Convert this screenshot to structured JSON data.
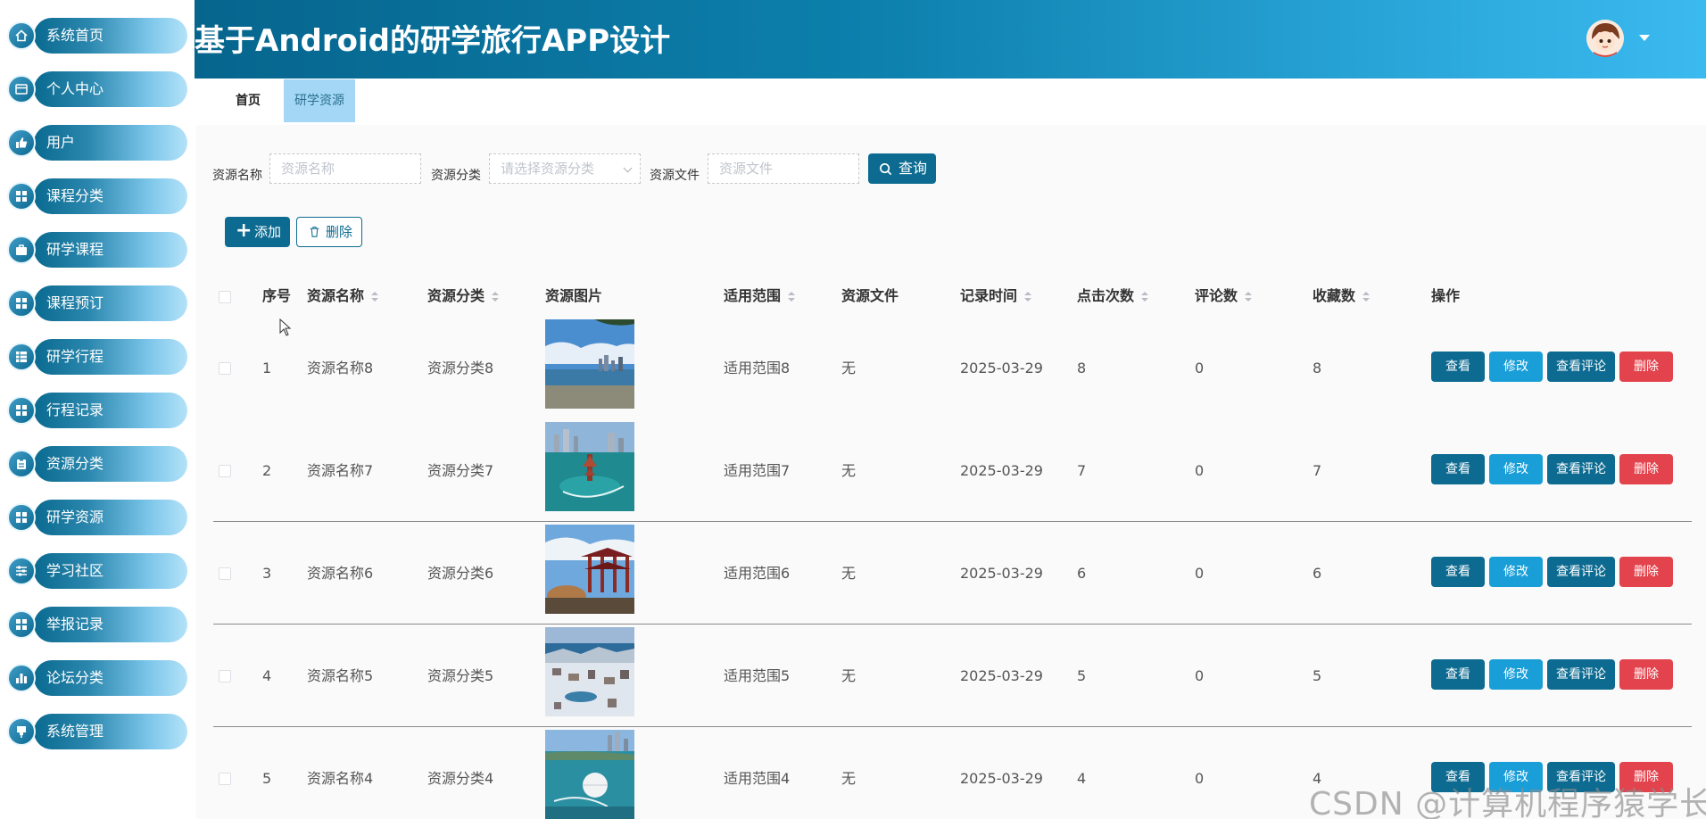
{
  "app": {
    "title": "基于Android的研学旅行APP设计"
  },
  "sidebar": {
    "items": [
      {
        "label": "系统首页",
        "icon": "home-icon"
      },
      {
        "label": "个人中心",
        "icon": "card-icon"
      },
      {
        "label": "用户",
        "icon": "thumb-icon"
      },
      {
        "label": "课程分类",
        "icon": "grid-icon"
      },
      {
        "label": "研学课程",
        "icon": "briefcase-icon"
      },
      {
        "label": "课程预订",
        "icon": "grid-icon"
      },
      {
        "label": "研学行程",
        "icon": "table-icon"
      },
      {
        "label": "行程记录",
        "icon": "grid-icon"
      },
      {
        "label": "资源分类",
        "icon": "clipboard-icon"
      },
      {
        "label": "研学资源",
        "icon": "grid-icon"
      },
      {
        "label": "学习社区",
        "icon": "sliders-icon"
      },
      {
        "label": "举报记录",
        "icon": "grid-icon"
      },
      {
        "label": "论坛分类",
        "icon": "bar-chart-icon"
      },
      {
        "label": "系统管理",
        "icon": "pin-icon"
      }
    ]
  },
  "tabs": [
    {
      "label": "首页",
      "active": false
    },
    {
      "label": "研学资源",
      "active": true
    }
  ],
  "search": {
    "name_label": "资源名称",
    "name_placeholder": "资源名称",
    "category_label": "资源分类",
    "category_placeholder": "请选择资源分类",
    "file_label": "资源文件",
    "file_placeholder": "资源文件",
    "query_button": "查询"
  },
  "toolbar": {
    "add_label": "添加",
    "delete_label": "删除"
  },
  "table": {
    "headers": {
      "index": "序号",
      "name": "资源名称",
      "category": "资源分类",
      "image": "资源图片",
      "scope": "适用范围",
      "file": "资源文件",
      "time": "记录时间",
      "clicks": "点击次数",
      "comments": "评论数",
      "favorites": "收藏数",
      "actions": "操作"
    },
    "action_labels": {
      "view": "查看",
      "edit": "修改",
      "comments": "查看评论",
      "delete": "删除"
    },
    "rows": [
      {
        "index": "1",
        "name": "资源名称8",
        "category": "资源分类8",
        "scope": "适用范围8",
        "file": "无",
        "time": "2025-03-29",
        "clicks": "8",
        "comments": "0",
        "favorites": "8"
      },
      {
        "index": "2",
        "name": "资源名称7",
        "category": "资源分类7",
        "scope": "适用范围7",
        "file": "无",
        "time": "2025-03-29",
        "clicks": "7",
        "comments": "0",
        "favorites": "7"
      },
      {
        "index": "3",
        "name": "资源名称6",
        "category": "资源分类6",
        "scope": "适用范围6",
        "file": "无",
        "time": "2025-03-29",
        "clicks": "6",
        "comments": "0",
        "favorites": "6"
      },
      {
        "index": "4",
        "name": "资源名称5",
        "category": "资源分类5",
        "scope": "适用范围5",
        "file": "无",
        "time": "2025-03-29",
        "clicks": "5",
        "comments": "0",
        "favorites": "5"
      },
      {
        "index": "5",
        "name": "资源名称4",
        "category": "资源分类4",
        "scope": "适用范围4",
        "file": "无",
        "time": "2025-03-29",
        "clicks": "4",
        "comments": "0",
        "favorites": "4"
      }
    ]
  },
  "watermark": "CSDN @计算机程序猿学长",
  "colors": {
    "primary": "#0d6b91",
    "secondary": "#1a9ed8",
    "danger": "#e2434d",
    "tab_active": "#a3d7f5"
  }
}
